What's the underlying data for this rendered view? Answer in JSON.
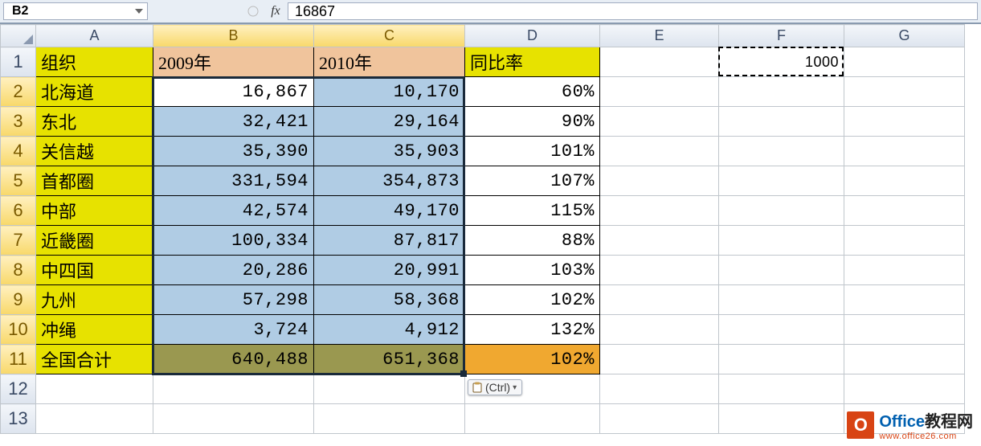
{
  "formula_bar": {
    "name_box": "B2",
    "fx_label": "fx",
    "formula_value": "16867"
  },
  "columns": [
    "A",
    "B",
    "C",
    "D",
    "E",
    "F",
    "G"
  ],
  "headers": {
    "org": "组织",
    "y2009": "2009年",
    "y2010": "2010年",
    "ratio": "同比率"
  },
  "rows": [
    {
      "label": "北海道",
      "y2009": "16,867",
      "y2010": "10,170",
      "ratio": "60%"
    },
    {
      "label": "东北",
      "y2009": "32,421",
      "y2010": "29,164",
      "ratio": "90%"
    },
    {
      "label": "关信越",
      "y2009": "35,390",
      "y2010": "35,903",
      "ratio": "101%"
    },
    {
      "label": "首都圈",
      "y2009": "331,594",
      "y2010": "354,873",
      "ratio": "107%"
    },
    {
      "label": "中部",
      "y2009": "42,574",
      "y2010": "49,170",
      "ratio": "115%"
    },
    {
      "label": "近畿圈",
      "y2009": "100,334",
      "y2010": "87,817",
      "ratio": "88%"
    },
    {
      "label": "中四国",
      "y2009": "20,286",
      "y2010": "20,991",
      "ratio": "103%"
    },
    {
      "label": "九州",
      "y2009": "57,298",
      "y2010": "58,368",
      "ratio": "102%"
    },
    {
      "label": "冲绳",
      "y2009": "3,724",
      "y2010": "4,912",
      "ratio": "132%"
    }
  ],
  "total": {
    "label": "全国合计",
    "y2009": "640,488",
    "y2010": "651,368",
    "ratio": "102%"
  },
  "f1_value": "1000",
  "paste_options_label": "(Ctrl)",
  "watermark": {
    "title_blue": "Office",
    "title_black": "教程网",
    "url": "www.office26.com",
    "logo_letter": "O"
  },
  "chart_data": {
    "type": "table",
    "columns": [
      "组织",
      "2009年",
      "2010年",
      "同比率"
    ],
    "rows": [
      [
        "北海道",
        16867,
        10170,
        0.6
      ],
      [
        "东北",
        32421,
        29164,
        0.9
      ],
      [
        "关信越",
        35390,
        35903,
        1.01
      ],
      [
        "首都圈",
        331594,
        354873,
        1.07
      ],
      [
        "中部",
        42574,
        49170,
        1.15
      ],
      [
        "近畿圈",
        100334,
        87817,
        0.88
      ],
      [
        "中四国",
        20286,
        20991,
        1.03
      ],
      [
        "九州",
        57298,
        58368,
        1.02
      ],
      [
        "冲绳",
        3724,
        4912,
        1.32
      ],
      [
        "全国合计",
        640488,
        651368,
        1.02
      ]
    ],
    "copied_cell": {
      "ref": "F1",
      "value": 1000
    }
  }
}
